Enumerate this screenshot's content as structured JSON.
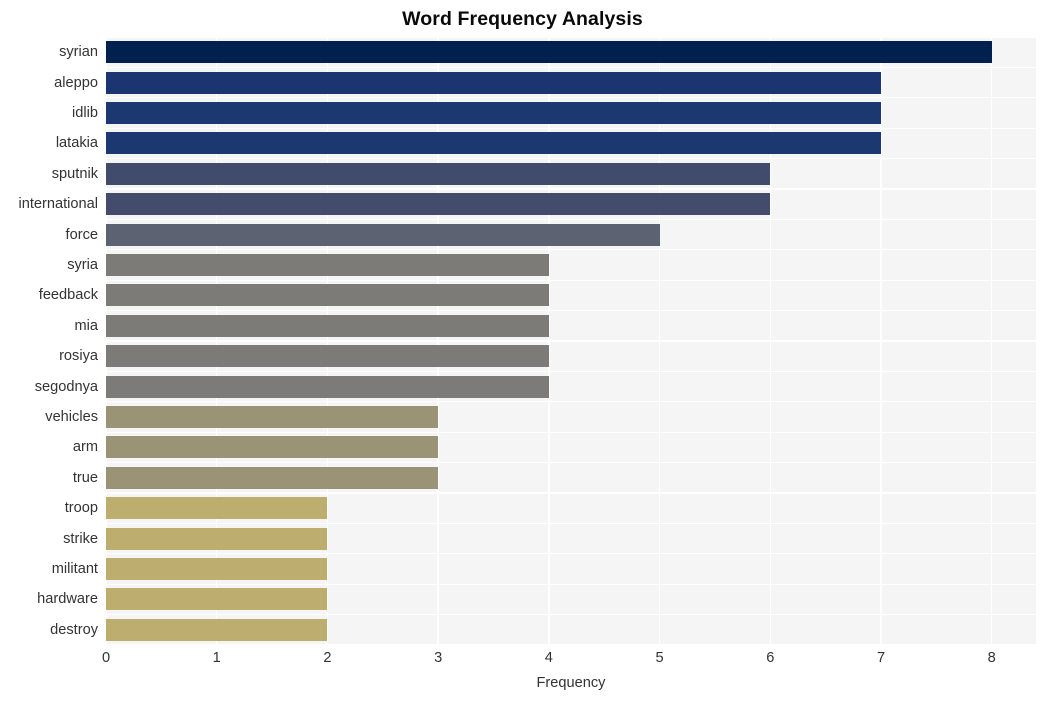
{
  "chart_data": {
    "type": "bar",
    "orientation": "horizontal",
    "title": "Word Frequency Analysis",
    "xlabel": "Frequency",
    "ylabel": "",
    "categories": [
      "syrian",
      "aleppo",
      "idlib",
      "latakia",
      "sputnik",
      "international",
      "force",
      "syria",
      "feedback",
      "mia",
      "rosiya",
      "segodnya",
      "vehicles",
      "arm",
      "true",
      "troop",
      "strike",
      "militant",
      "hardware",
      "destroy"
    ],
    "values": [
      8,
      7,
      7,
      7,
      6,
      6,
      5,
      4,
      4,
      4,
      4,
      4,
      3,
      3,
      3,
      2,
      2,
      2,
      2,
      2
    ],
    "bar_colors": [
      "#00204e",
      "#1a3570",
      "#1c3871",
      "#1c3871",
      "#414b6b",
      "#434c6c",
      "#5c6271",
      "#7c7b78",
      "#7c7b78",
      "#7c7b78",
      "#7c7b78",
      "#7c7b78",
      "#9a9375",
      "#9a9375",
      "#9a9375",
      "#bdad6e",
      "#bdad6e",
      "#bdad6e",
      "#bdad6e",
      "#bdad6e"
    ],
    "xlim": [
      0,
      8.4
    ],
    "xticks": [
      0,
      1,
      2,
      3,
      4,
      5,
      6,
      7,
      8
    ],
    "xtick_labels": [
      "0",
      "1",
      "2",
      "3",
      "4",
      "5",
      "6",
      "7",
      "8"
    ],
    "grid": true,
    "grid_color": "#ffffff",
    "plot_background": "#f5f5f5",
    "figure_background": "#ffffff",
    "legend": null,
    "colormap": "cividis"
  }
}
